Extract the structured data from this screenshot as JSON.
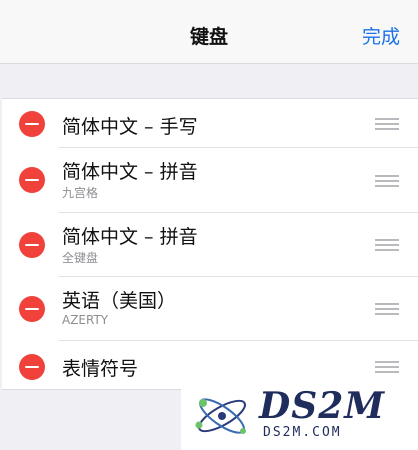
{
  "navbar": {
    "title": "键盘",
    "done_label": "完成"
  },
  "keyboards": [
    {
      "title": "简体中文 – 手写",
      "subtitle": ""
    },
    {
      "title": "简体中文 – 拼音",
      "subtitle": "九宫格"
    },
    {
      "title": "简体中文 – 拼音",
      "subtitle": "全键盘"
    },
    {
      "title": "英语（美国）",
      "subtitle": "AZERTY"
    },
    {
      "title": "表情符号",
      "subtitle": ""
    }
  ],
  "watermark": {
    "logo_text": "DS2M",
    "url": "DS2M.COM"
  },
  "colors": {
    "accent": "#1a73e8",
    "delete": "#f0413b",
    "background": "#efeff4"
  }
}
